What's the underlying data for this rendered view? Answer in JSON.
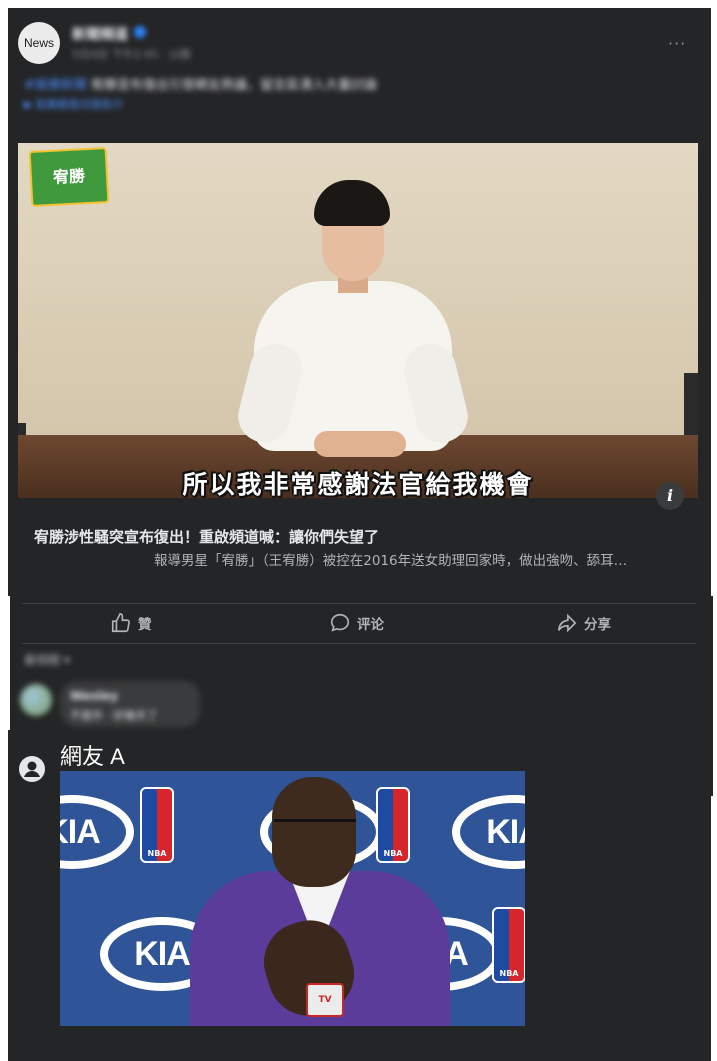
{
  "post": {
    "page_avatar_text": "News",
    "page_name": "新聞頻道",
    "time": "5月4日 下午2:45 · 公開",
    "more_label": "···",
    "text_tag": "#娛樂新聞",
    "text": "宥勝宣布復出引發網友熱議，留言區湧入大量討論",
    "sub_link": "▶ 點擊觀看完整影片"
  },
  "video": {
    "channel_logo_text": "宥勝",
    "subtitle": "所以我非常感謝法官給我機會"
  },
  "link_preview": {
    "title": "宥勝涉性騷突宣布復出！重啟頻道喊：讓你們失望了",
    "description": "報導男星「宥勝」（王宥勝）被控在2016年送女助理回家時，做出強吻、舔耳…"
  },
  "actions": {
    "like": "贊",
    "comment": "评论",
    "share": "分享"
  },
  "comments": {
    "sort_label": "最相關 ▾",
    "first": {
      "name": "Wesley",
      "text": "不意外 · 好幾天了"
    },
    "netizen_label": "網友 A"
  },
  "photo": {
    "kia_text": "KIA",
    "nba_text": "NBA",
    "mic_text": "TV"
  }
}
